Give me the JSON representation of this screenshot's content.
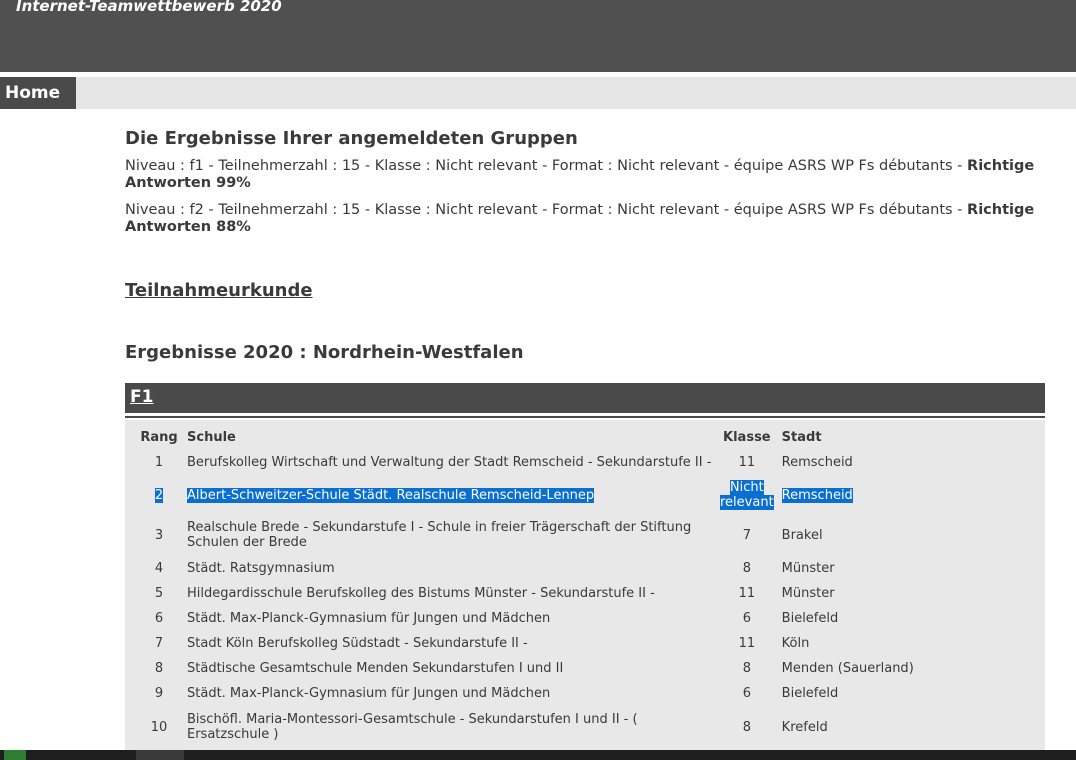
{
  "site": {
    "title": "Internet-Teamwettbewerb 2020"
  },
  "nav": {
    "home_label": "Home"
  },
  "groups_section": {
    "title": "Die Ergebnisse Ihrer angemeldeten Gruppen",
    "lines": [
      {
        "text": "Niveau : f1 - Teilnehmerzahl : 15 - Klasse : Nicht relevant - Format : Nicht relevant - équipe ASRS WP Fs débutants - ",
        "bold": "Richtige Antworten 99%"
      },
      {
        "text": "Niveau : f2 - Teilnehmerzahl : 15 - Klasse : Nicht relevant - Format : Nicht relevant - équipe ASRS WP Fs débutants - ",
        "bold": "Richtige Antworten 88%"
      }
    ]
  },
  "certificate": {
    "label": "Teilnahmeurkunde"
  },
  "results": {
    "heading": "Ergebnisse 2020 : Nordrhein-Westfalen",
    "group_label": "F1",
    "columns": {
      "rank": "Rang",
      "school": "Schule",
      "class": "Klasse",
      "city": "Stadt"
    },
    "rows": [
      {
        "rank": "1",
        "school": "Berufskolleg Wirtschaft und Verwaltung der Stadt Remscheid - Sekundarstufe II -",
        "class": "11",
        "city": "Remscheid"
      },
      {
        "rank": "2",
        "school": "Albert-Schweitzer-Schule Städt. Realschule Remscheid-Lennep",
        "class": "Nicht relevant",
        "city": "Remscheid",
        "selected": true
      },
      {
        "rank": "3",
        "school": "Realschule Brede - Sekundarstufe I - Schule in freier Trägerschaft der Stiftung Schulen der Brede",
        "class": "7",
        "city": "Brakel"
      },
      {
        "rank": "4",
        "school": "Städt. Ratsgymnasium",
        "class": "8",
        "city": "Münster"
      },
      {
        "rank": "5",
        "school": "Hildegardisschule Berufskolleg des Bistums Münster - Sekundarstufe II -",
        "class": "11",
        "city": "Münster"
      },
      {
        "rank": "6",
        "school": "Städt. Max-Planck-Gymnasium für Jungen und Mädchen",
        "class": "6",
        "city": "Bielefeld"
      },
      {
        "rank": "7",
        "school": "Stadt Köln Berufskolleg Südstadt - Sekundarstufe II -",
        "class": "11",
        "city": "Köln"
      },
      {
        "rank": "8",
        "school": "Städtische Gesamtschule Menden Sekundarstufen I und II",
        "class": "8",
        "city": "Menden (Sauerland)"
      },
      {
        "rank": "9",
        "school": "Städt. Max-Planck-Gymnasium für Jungen und Mädchen",
        "class": "6",
        "city": "Bielefeld"
      },
      {
        "rank": "10",
        "school": "Bischöfl. Maria-Montessori-Gesamtschule - Sekundarstufen I und II - ( Ersatzschule )",
        "class": "8",
        "city": "Krefeld"
      }
    ]
  },
  "colors": {
    "dark_bar": "#4a4a4a",
    "panel": "#e8e8e8",
    "selection": "#0a6fce"
  }
}
